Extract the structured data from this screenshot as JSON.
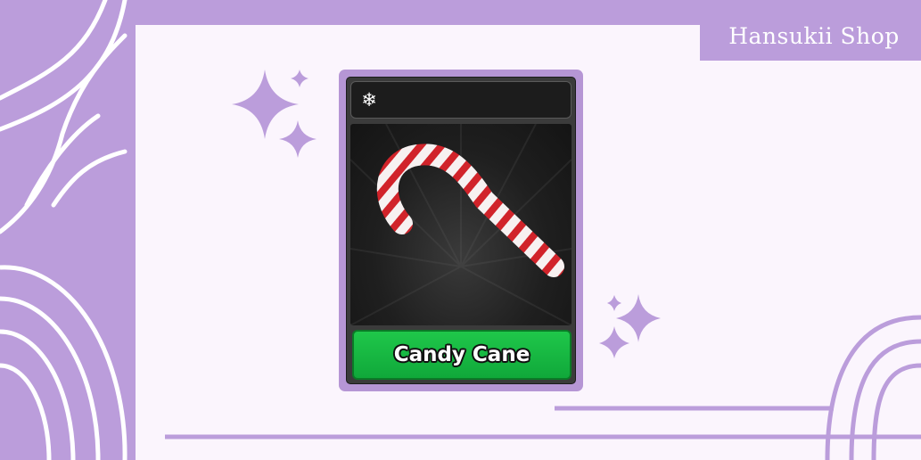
{
  "shop": {
    "name": "Hansukii Shop"
  },
  "item": {
    "name": "Candy Cane",
    "badge_icon": "snowflake-icon",
    "badge_glyph": "❄",
    "rarity_color": "#16b83f"
  },
  "colors": {
    "lavender": "#bb9ddb",
    "panel": "#fbf5fd",
    "card_border": "#b696d5"
  },
  "decorations": [
    "sparkle-icon",
    "sparkle-icon",
    "sparkle-icon",
    "sparkle-icon",
    "sparkle-icon",
    "sparkle-icon"
  ]
}
